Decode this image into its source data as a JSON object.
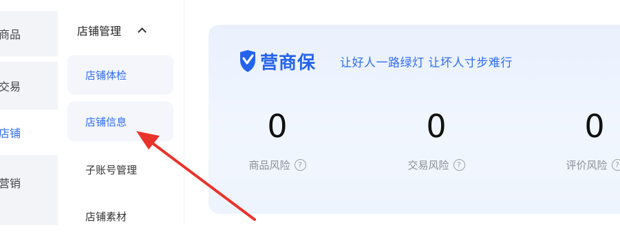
{
  "primary_nav": {
    "items": [
      {
        "label": "商品"
      },
      {
        "label": "交易"
      },
      {
        "label": "店铺"
      },
      {
        "label": "营销"
      }
    ]
  },
  "secondary_nav": {
    "group_title": "店铺管理",
    "items": [
      {
        "label": "店铺体检"
      },
      {
        "label": "店铺信息"
      },
      {
        "label": "子账号管理"
      },
      {
        "label": "店铺素材"
      }
    ]
  },
  "card": {
    "brand_name": "营商保",
    "slogan": "让好人一路绿灯 让坏人寸步难行",
    "metrics": [
      {
        "value": "0",
        "label": "商品风险"
      },
      {
        "value": "0",
        "label": "交易风险"
      },
      {
        "value": "0",
        "label": "评价风险"
      }
    ],
    "help_glyph": "?"
  },
  "colors": {
    "accent": "#2e6bf6",
    "annotation_arrow": "#e8332b"
  }
}
